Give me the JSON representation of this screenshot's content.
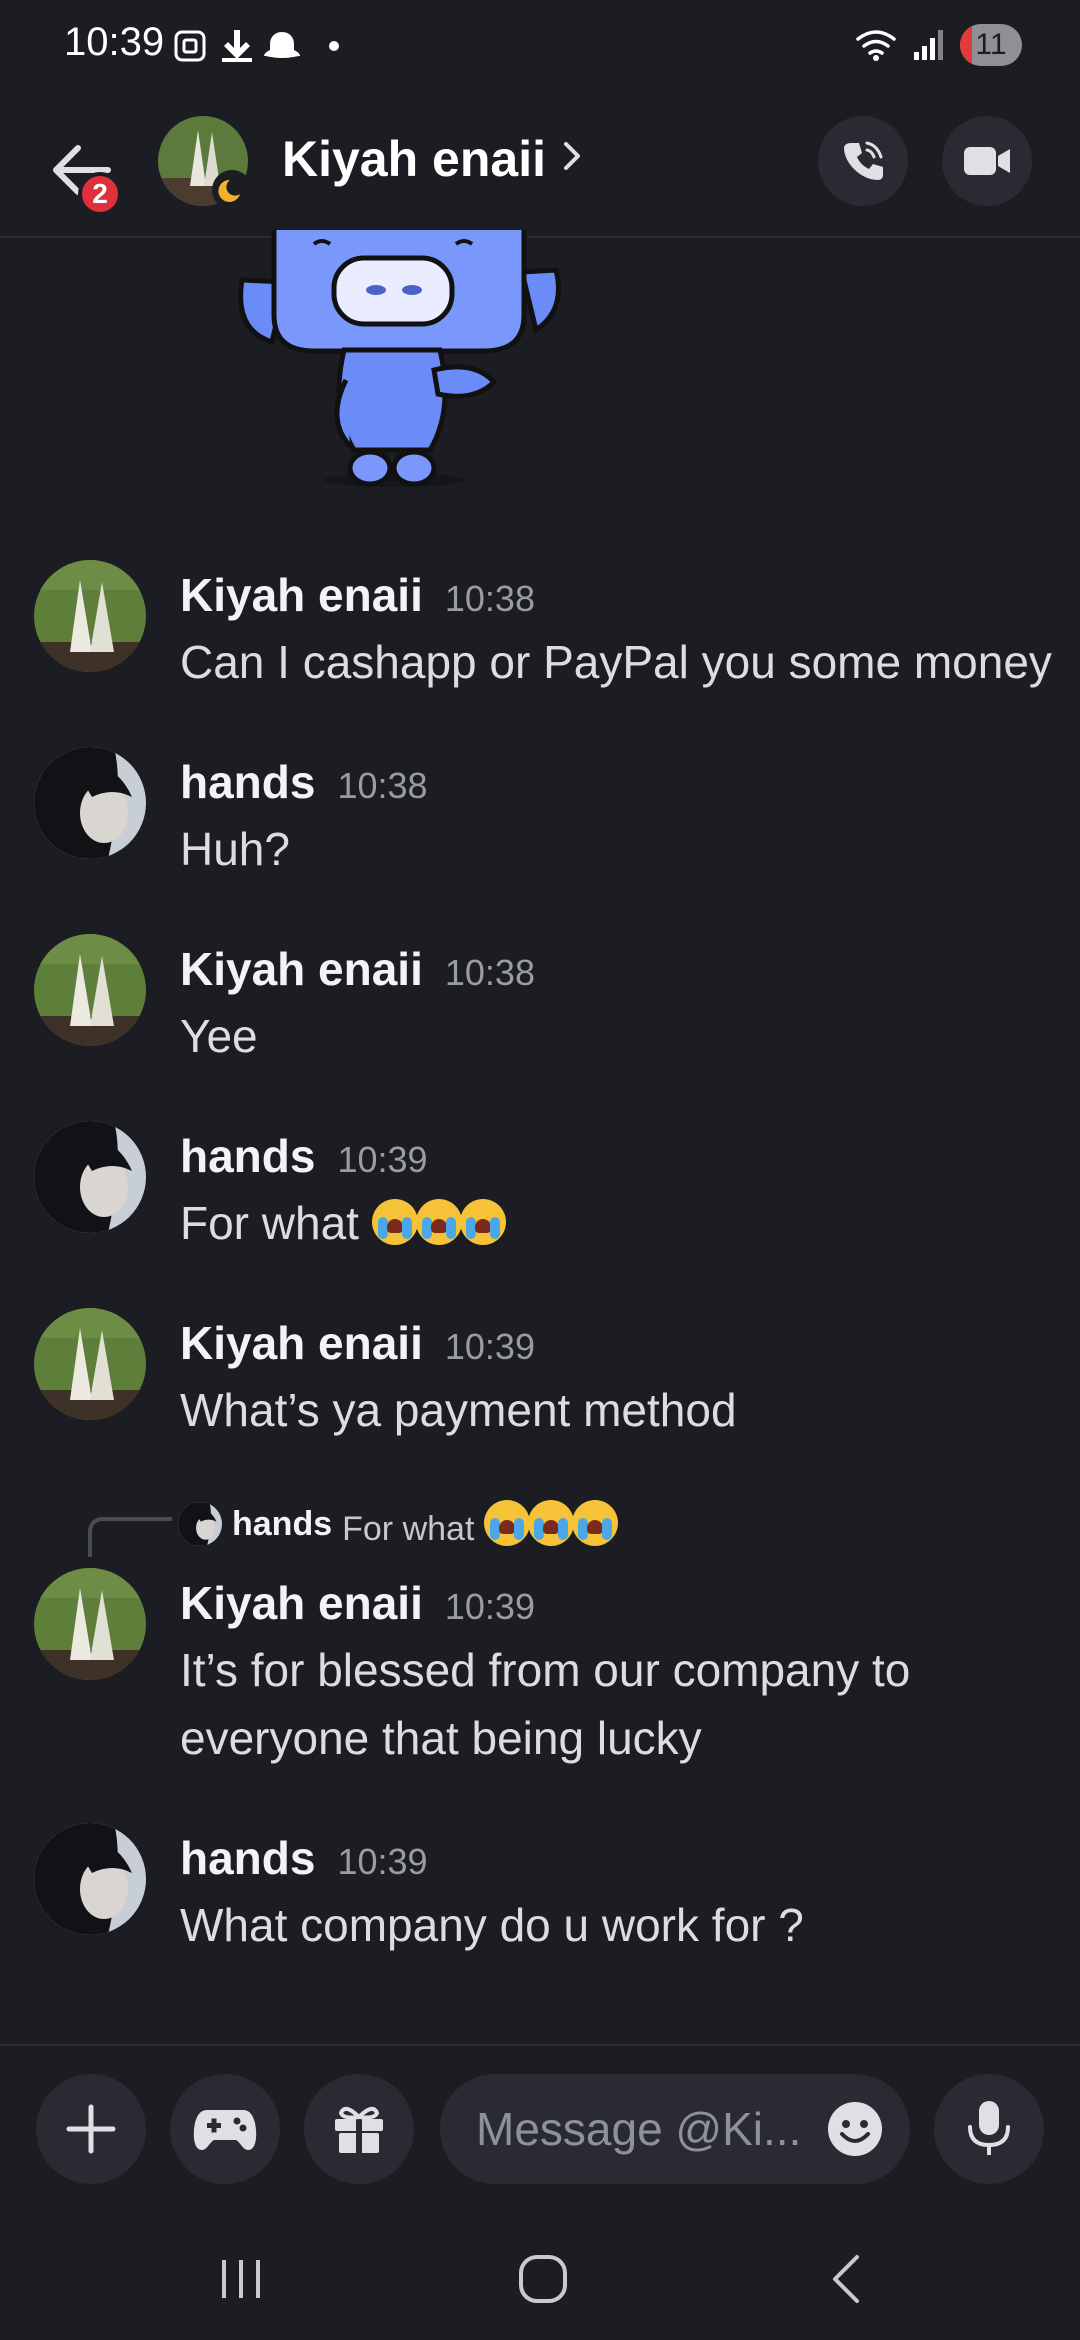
{
  "status_bar": {
    "time": "10:39",
    "battery_level": "11",
    "battery_fraction": 0.11
  },
  "header": {
    "back_badge": "2",
    "title": "Kiyah enaii",
    "status": "idle"
  },
  "messages": [
    {
      "author": "Kiyah enaii",
      "time": "10:38",
      "text": "Can I cashapp or PayPal you some money",
      "avatar": "feet-photo"
    },
    {
      "author": "hands",
      "time": "10:38",
      "text": "Huh?",
      "avatar": "dark-hair-photo"
    },
    {
      "author": "Kiyah enaii",
      "time": "10:38",
      "text": "Yee",
      "avatar": "feet-photo"
    },
    {
      "author": "hands",
      "time": "10:39",
      "text": "For what",
      "emoji": "loudly-crying-face",
      "emoji_count": 3,
      "avatar": "dark-hair-photo"
    },
    {
      "author": "Kiyah enaii",
      "time": "10:39",
      "text": "What’s ya payment method",
      "avatar": "feet-photo"
    },
    {
      "author": "Kiyah enaii",
      "time": "10:39",
      "text": "It’s for blessed from our company to everyone that being lucky",
      "avatar": "feet-photo",
      "reply_to": {
        "author": "hands",
        "text": "For what",
        "emoji": "loudly-crying-face",
        "emoji_count": 3
      }
    },
    {
      "author": "hands",
      "time": "10:39",
      "text": "What company do u work for ?",
      "avatar": "dark-hair-photo"
    }
  ],
  "sticker": {
    "name": "wumpus-wave-sticker"
  },
  "composer": {
    "placeholder": "Message @Ki..."
  },
  "colors": {
    "background": "#1c1d23",
    "badge_red": "#e0303b",
    "idle_yellow": "#f0b132",
    "button_bg": "#2a2b32",
    "wumpus_blue": "#6b8cf7"
  }
}
